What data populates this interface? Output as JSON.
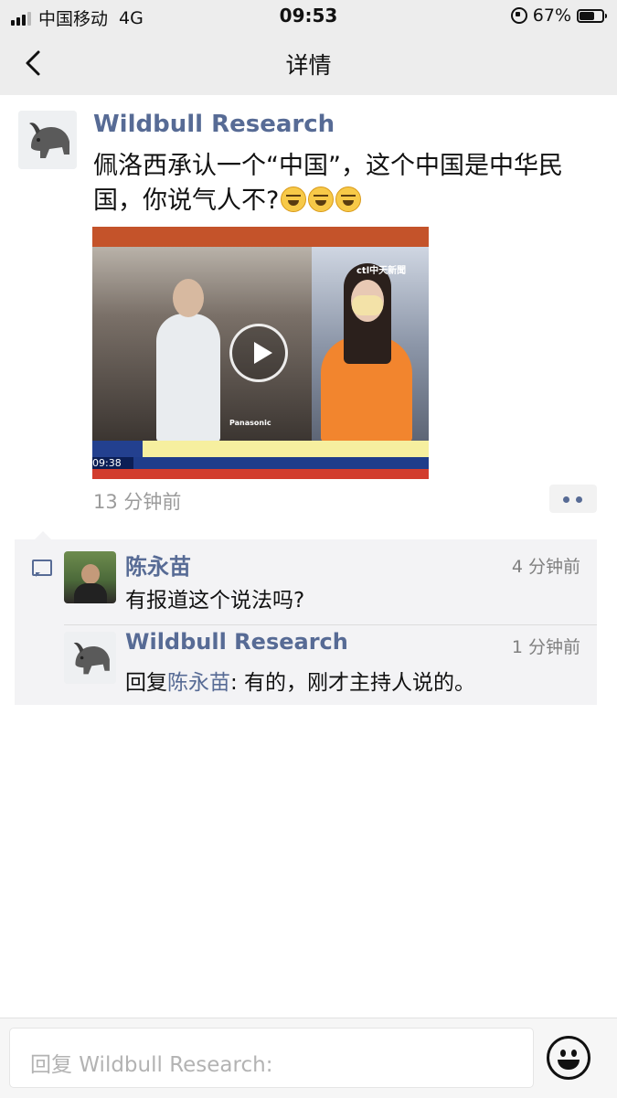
{
  "status_bar": {
    "carrier": "中国移动",
    "network": "4G",
    "time": "09:53",
    "battery_pct": "67%",
    "battery_level": 0.67
  },
  "nav": {
    "title": "详情",
    "back_icon": "chevron-left-icon"
  },
  "post": {
    "author": "Wildbull Research",
    "avatar_icon": "bison-avatar",
    "text": "佩洛西承认一个“中国”，这个中国是中华民国，你说气人不?",
    "emoji_icon": "laughing-crying-emoji",
    "emoji_count": 3,
    "video": {
      "channel_logo": "ctl中天新聞",
      "brand": "Panasonic",
      "ticker_time": "09:38"
    },
    "time": "13 分钟前",
    "more_icon": "more-dots-icon"
  },
  "comments": [
    {
      "author": "陈永苗",
      "text": "有报道这个说法吗?",
      "time": "4 分钟前"
    },
    {
      "author": "Wildbull Research",
      "reply_prefix": "回复",
      "reply_to": "陈永苗",
      "text": ": 有的，刚才主持人说的。",
      "time": "1 分钟前"
    }
  ],
  "reply_bar": {
    "placeholder": "回复 Wildbull Research:",
    "emoji_icon": "smile-icon"
  },
  "colors": {
    "link": "#576b95",
    "bar_bg": "#ededed",
    "comment_bg": "#f3f3f5"
  }
}
